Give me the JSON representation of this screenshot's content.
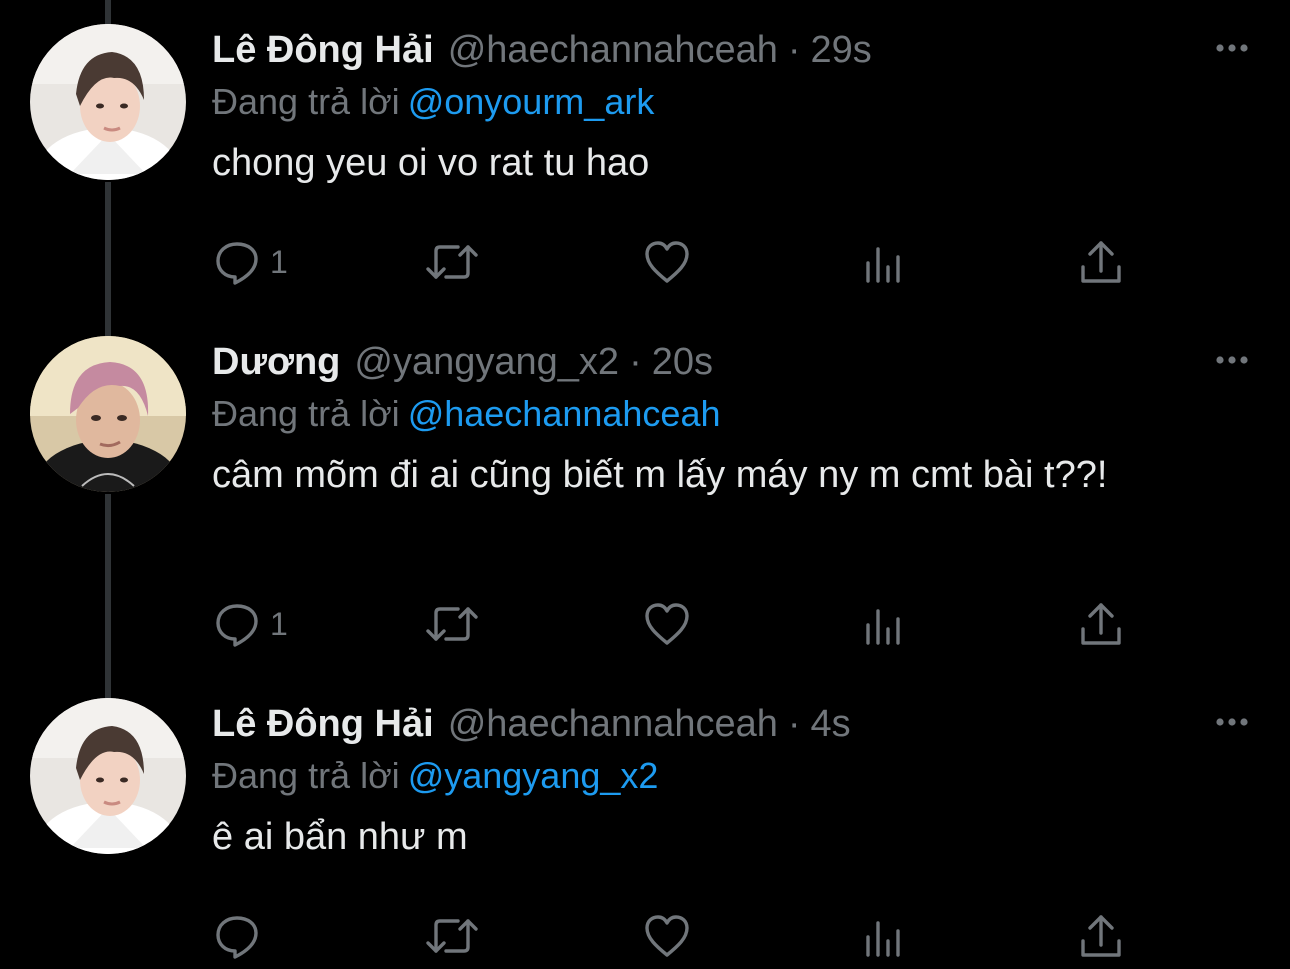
{
  "reply_prefix": "Đang trả lời",
  "colors": {
    "background": "#000000",
    "primary_text": "#e7e9ea",
    "secondary_text": "#71767b",
    "mention": "#1d9bf0",
    "thread_line": "#2f3336"
  },
  "tweets": [
    {
      "display_name": "Lê Đông Hải",
      "handle": "@haechannahceah",
      "separator": "·",
      "time": "29s",
      "replying_to": "@onyourm_ark",
      "text": "chong yeu oi vo rat tu hao",
      "reply_count": "1",
      "avatar_icon": "avatar-photo"
    },
    {
      "display_name": "Dương",
      "handle": "@yangyang_x2",
      "separator": "·",
      "time": "20s",
      "replying_to": "@haechannahceah",
      "text": "câm mõm đi ai cũng biết m lấy máy ny m cmt bài t??!",
      "reply_count": "1",
      "avatar_icon": "avatar-photo"
    },
    {
      "display_name": "Lê Đông Hải",
      "handle": "@haechannahceah",
      "separator": "·",
      "time": "4s",
      "replying_to": "@yangyang_x2",
      "text": "ê ai bẩn như m",
      "reply_count": "",
      "avatar_icon": "avatar-photo"
    }
  ],
  "action_icons": [
    "reply-icon",
    "retweet-icon",
    "like-icon",
    "views-icon",
    "share-icon"
  ]
}
